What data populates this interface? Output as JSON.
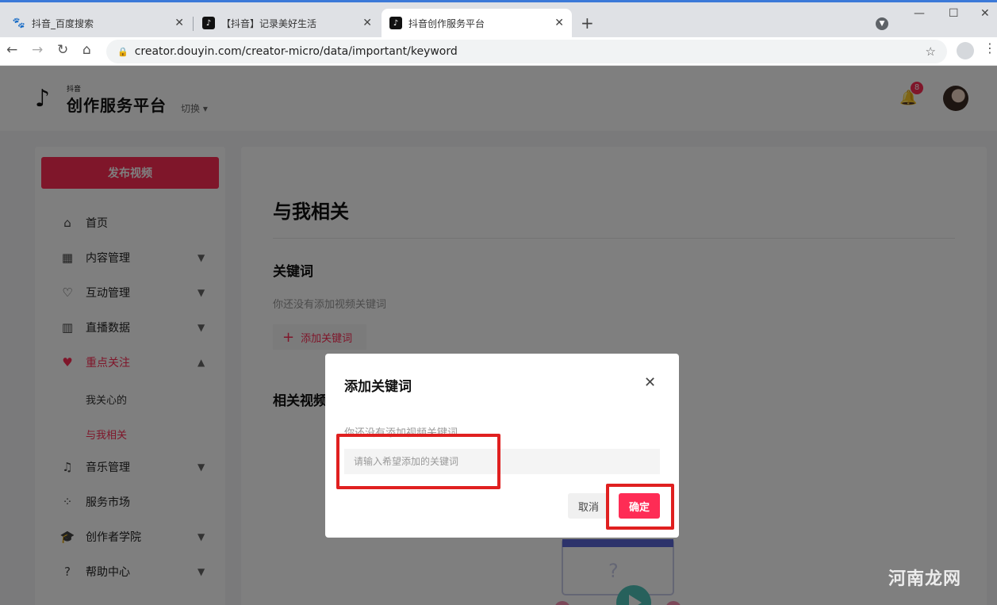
{
  "browser": {
    "tabs": [
      {
        "title": "抖音_百度搜索",
        "favicon": "baidu-paw-icon"
      },
      {
        "title": "【抖音】记录美好生活",
        "favicon": "tiktok-icon"
      },
      {
        "title": "抖音创作服务平台",
        "favicon": "tiktok-icon",
        "active": true
      }
    ],
    "url": "creator.douyin.com/creator-micro/data/important/keyword"
  },
  "header": {
    "logo_small": "抖音",
    "logo_title": "创作服务平台",
    "switch_label": "切换",
    "notification_count": "8"
  },
  "sidebar": {
    "publish_label": "发布视频",
    "items": [
      {
        "label": "首页",
        "icon": "home-icon"
      },
      {
        "label": "内容管理",
        "icon": "grid-icon",
        "expandable": true
      },
      {
        "label": "互动管理",
        "icon": "heart-shield-icon",
        "expandable": true
      },
      {
        "label": "直播数据",
        "icon": "bar-chart-icon",
        "expandable": true
      },
      {
        "label": "重点关注",
        "icon": "heart-icon",
        "expandable": true,
        "active": true
      },
      {
        "label": "音乐管理",
        "icon": "music-note-icon",
        "expandable": true
      },
      {
        "label": "服务市场",
        "icon": "apps-icon"
      },
      {
        "label": "创作者学院",
        "icon": "graduation-cap-icon",
        "expandable": true
      },
      {
        "label": "帮助中心",
        "icon": "help-icon",
        "expandable": true
      }
    ],
    "sub_items": [
      {
        "label": "我关心的"
      },
      {
        "label": "与我相关",
        "active": true
      }
    ]
  },
  "main": {
    "title": "与我相关",
    "keyword_section_title": "关键词",
    "keyword_empty_hint": "你还没有添加视频关键词",
    "add_keyword_label": "添加关键词",
    "related_section_title": "相关视频"
  },
  "modal": {
    "title": "添加关键词",
    "hint": "你还没有添加视频关键词",
    "input_placeholder": "请输入希望添加的关键词",
    "input_value": "",
    "cancel_label": "取消",
    "confirm_label": "确定"
  },
  "watermark": "河南龙网",
  "colors": {
    "brand": "#fe2c55",
    "annotation": "#e02020"
  }
}
